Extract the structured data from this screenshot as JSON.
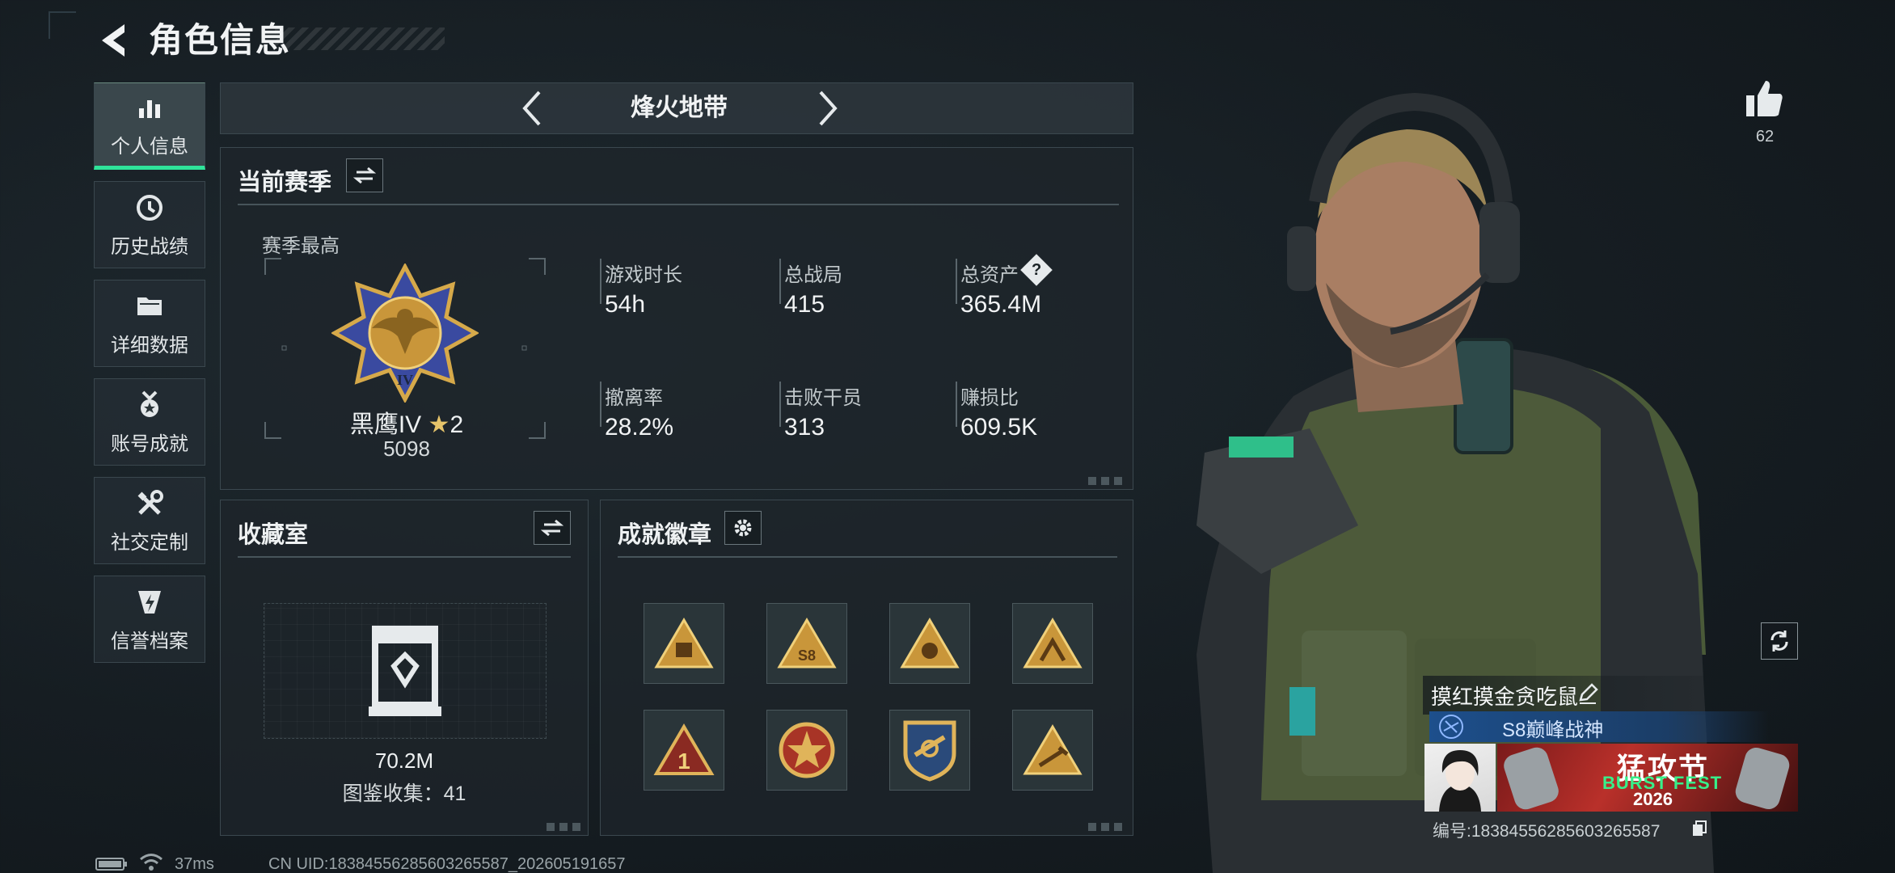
{
  "header": {
    "title": "角色信息"
  },
  "sidebar": {
    "items": [
      {
        "label": "个人信息",
        "icon": "bar-chart-icon",
        "active": true
      },
      {
        "label": "历史战绩",
        "icon": "clock-icon"
      },
      {
        "label": "详细数据",
        "icon": "folder-icon"
      },
      {
        "label": "账号成就",
        "icon": "medal-icon"
      },
      {
        "label": "社交定制",
        "icon": "tools-icon"
      },
      {
        "label": "信誉档案",
        "icon": "shield-bolt-icon"
      }
    ]
  },
  "mode": {
    "title": "烽火地带"
  },
  "season": {
    "title": "当前赛季",
    "best_label": "赛季最高",
    "rank_name": "黑鹰IV",
    "rank_stars": "2",
    "rank_points": "5098",
    "stats": [
      {
        "label": "游戏时长",
        "value": "54h"
      },
      {
        "label": "总战局",
        "value": "415"
      },
      {
        "label": "总资产",
        "value": "365.4M",
        "help": "?"
      },
      {
        "label": "撤离率",
        "value": "28.2%"
      },
      {
        "label": "击败干员",
        "value": "313"
      },
      {
        "label": "赚损比",
        "value": "609.5K"
      }
    ]
  },
  "collection": {
    "title": "收藏室",
    "value": "70.2M",
    "count_text": "图鉴收集：41"
  },
  "achievements": {
    "title": "成就徽章",
    "badges": [
      "triangle-badge-1",
      "s8-triangle-badge",
      "triangle-badge-2",
      "triangle-badge-3",
      "number-one-badge",
      "star-medal-badge",
      "shield-crest-badge",
      "triangle-badge-4"
    ]
  },
  "character": {
    "likes": "62",
    "name": "摸红摸金贪吃鼠",
    "title": "S8巅峰战神",
    "banner_top": "猛攻节",
    "banner_mid": "BURST FEST",
    "banner_bottom": "2026",
    "id_text": "编号:18384556285603265587"
  },
  "status": {
    "ping": "37ms",
    "uid": "CN UID:18384556285603265587_202605191657"
  },
  "colors": {
    "accent": "#2fe39a",
    "gold": "#c9963a",
    "title_blue": "#1d4f8c"
  }
}
